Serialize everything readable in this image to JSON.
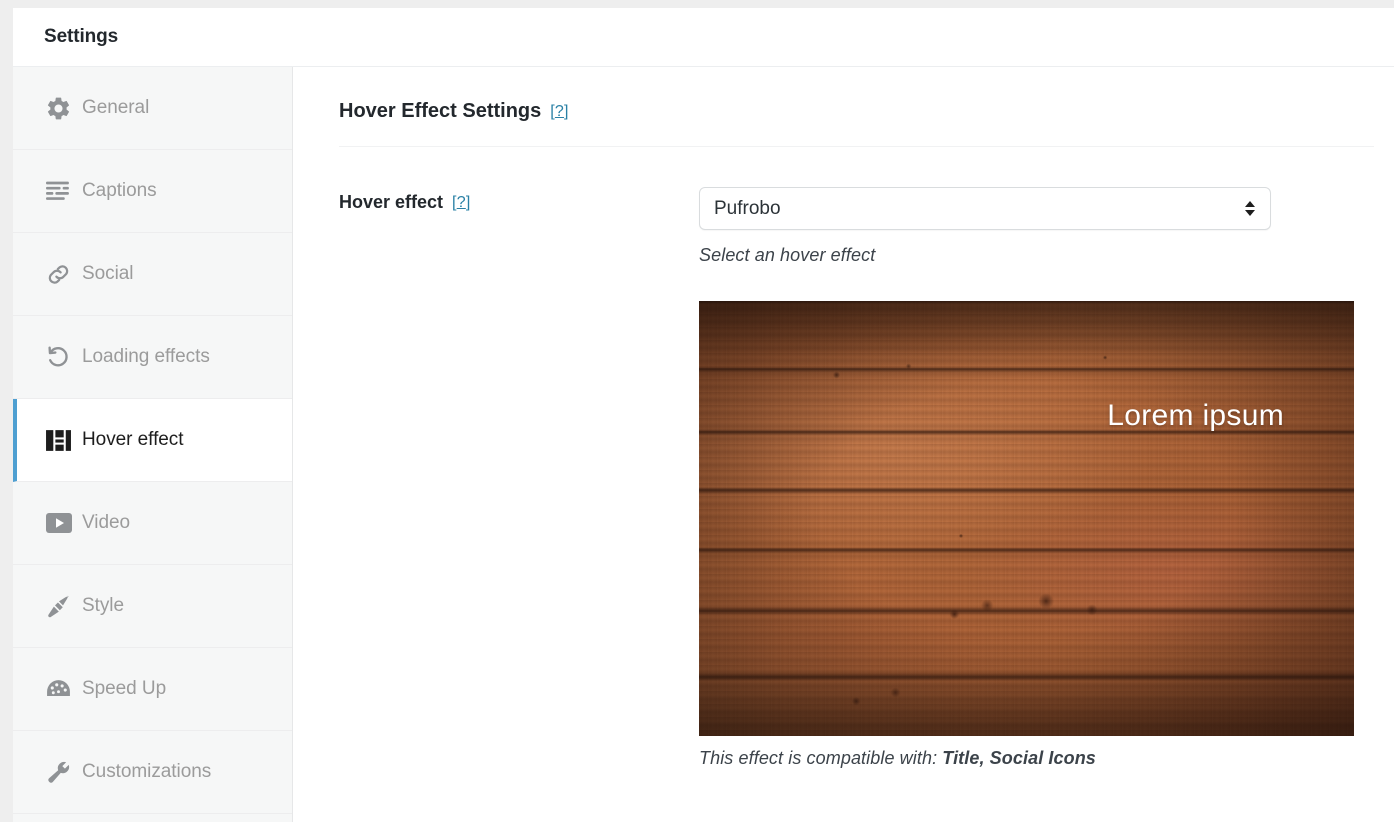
{
  "window": {
    "title": "Settings"
  },
  "sidebar": {
    "items": [
      {
        "label": "General",
        "icon": "gear-icon",
        "active": false
      },
      {
        "label": "Captions",
        "icon": "captions-icon",
        "active": false
      },
      {
        "label": "Social",
        "icon": "link-icon",
        "active": false
      },
      {
        "label": "Loading effects",
        "icon": "refresh-icon",
        "active": false
      },
      {
        "label": "Hover effect",
        "icon": "layout-icon",
        "active": true
      },
      {
        "label": "Video",
        "icon": "play-icon",
        "active": false
      },
      {
        "label": "Style",
        "icon": "paintbrush-icon",
        "active": false
      },
      {
        "label": "Speed Up",
        "icon": "gauge-icon",
        "active": false
      },
      {
        "label": "Customizations",
        "icon": "wrench-icon",
        "active": false
      }
    ]
  },
  "main": {
    "section_title": "Hover Effect Settings",
    "section_help": "[?]",
    "field": {
      "label": "Hover effect",
      "help": "[?]",
      "selected_value": "Pufrobo",
      "options": [
        "Pufrobo"
      ],
      "description": "Select an hover effect"
    },
    "preview": {
      "caption_text": "Lorem ipsum"
    },
    "compatibility": {
      "prefix": "This effect is compatible with: ",
      "items": "Title, Social Icons"
    }
  },
  "colors": {
    "accent": "#4e9fd1",
    "link": "#2980a5",
    "sidebar_bg": "#f6f7f7",
    "text_dark": "#23282d",
    "text_muted": "#9b9b9b"
  }
}
